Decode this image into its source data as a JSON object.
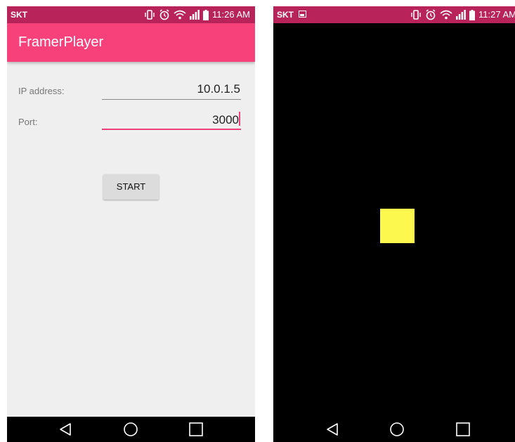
{
  "colors": {
    "status_bar": "#b8245a",
    "app_bar": "#f6417b",
    "accent": "#f03f7b",
    "layer_fill": "#fcf84e"
  },
  "left_screen": {
    "status_bar": {
      "carrier": "SKT",
      "time": "11:26 AM",
      "icons": [
        "vibrate-icon",
        "alarm-icon",
        "wifi-icon",
        "signal-icon",
        "battery-icon"
      ]
    },
    "app_bar": {
      "title": "FramerPlayer"
    },
    "form": {
      "ip_label": "IP address:",
      "ip_value": "10.0.1.5",
      "port_label": "Port:",
      "port_value": "3000",
      "start_label": "START"
    },
    "nav_bar": {
      "icons": [
        "back-icon",
        "home-icon",
        "recents-icon"
      ]
    }
  },
  "right_screen": {
    "status_bar": {
      "carrier": "SKT",
      "time": "11:27 AM",
      "icons": [
        "gallery-icon",
        "vibrate-icon",
        "alarm-icon",
        "wifi-icon",
        "signal-icon",
        "battery-icon"
      ]
    },
    "canvas": {
      "layer": "yellow-square"
    },
    "nav_bar": {
      "icons": [
        "back-icon",
        "home-icon",
        "recents-icon"
      ]
    }
  }
}
